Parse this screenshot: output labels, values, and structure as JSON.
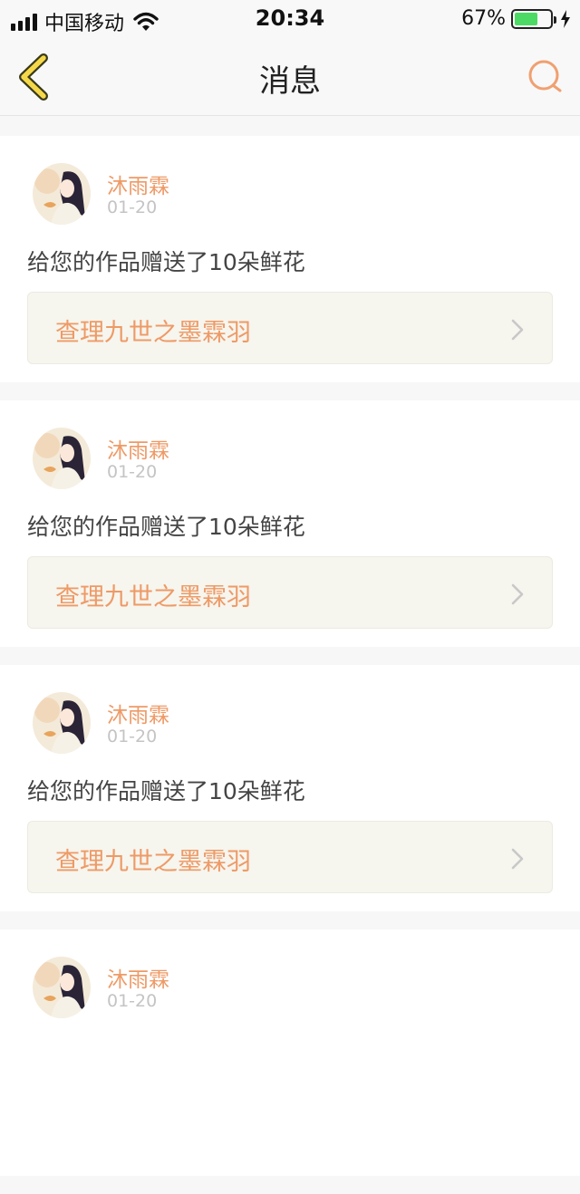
{
  "status_bar": {
    "carrier": "中国移动",
    "time": "20:34",
    "battery_percent_text": "67%",
    "battery_level": 0.67,
    "charging": true,
    "icons": [
      "signal-bars-icon",
      "wifi-icon",
      "battery-icon",
      "charging-bolt-icon"
    ]
  },
  "header": {
    "title": "消息",
    "back_icon": "chevron-left-icon",
    "search_icon": "search-icon",
    "accent_color": "#f0a070",
    "back_color": "#f5d84a"
  },
  "messages": [
    {
      "sender": "沐雨霖",
      "date": "01-20",
      "text": "给您的作品赠送了10朵鲜花",
      "work_title": "查理九世之墨霖羽"
    },
    {
      "sender": "沐雨霖",
      "date": "01-20",
      "text": "给您的作品赠送了10朵鲜花",
      "work_title": "查理九世之墨霖羽"
    },
    {
      "sender": "沐雨霖",
      "date": "01-20",
      "text": "给您的作品赠送了10朵鲜花",
      "work_title": "查理九世之墨霖羽"
    },
    {
      "sender": "沐雨霖",
      "date": "01-20"
    }
  ]
}
